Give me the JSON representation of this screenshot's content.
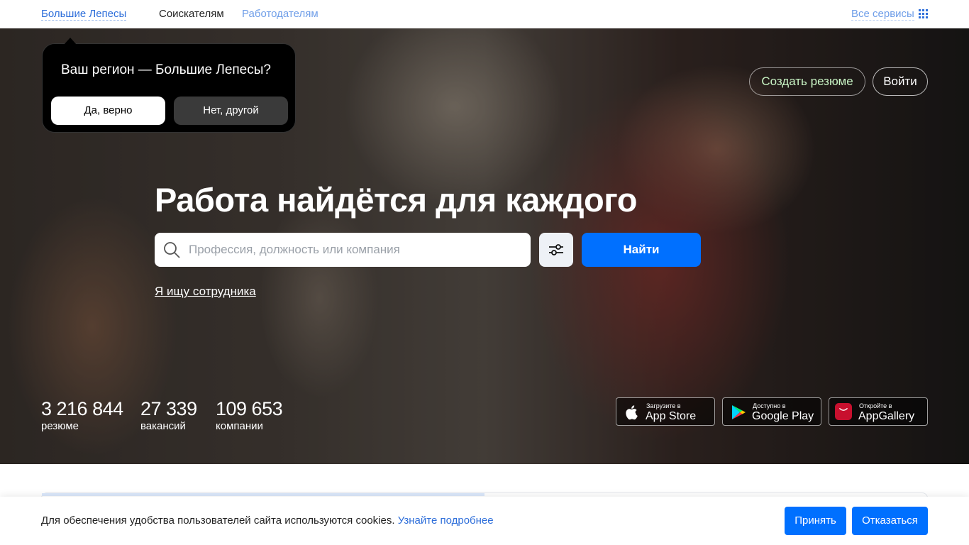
{
  "nav": {
    "region": "Большие Лепесы",
    "seekers": "Соискателям",
    "employers": "Работодателям",
    "all_services": "Все сервисы",
    "all_services_icon": "grid-icon"
  },
  "region_popup": {
    "title": "Ваш регион — Большие Лепесы?",
    "yes": "Да, верно",
    "no": "Нет, другой"
  },
  "header_actions": {
    "create_resume": "Создать резюме",
    "login": "Войти"
  },
  "hero": {
    "title": "Работа найдётся для каждого",
    "search_placeholder": "Профессия, должность или компания",
    "search_value": "",
    "search_icon": "search-icon",
    "filter_icon": "filters-icon",
    "find": "Найти",
    "employer_link": "Я ищу сотрудника"
  },
  "stats": [
    {
      "value": "3 216 844",
      "label": "резюме"
    },
    {
      "value": "27 339",
      "label": "вакансий"
    },
    {
      "value": "109 653",
      "label": "компании"
    }
  ],
  "stores": [
    {
      "small": "Загрузите в",
      "big": "App Store",
      "icon": "apple-icon"
    },
    {
      "small": "Доступно в",
      "big": "Google Play",
      "icon": "google-play-icon"
    },
    {
      "small": "Откройте в",
      "big": "AppGallery",
      "icon": "huawei-icon"
    }
  ],
  "cookie": {
    "text": "Для обеспечения удобства пользователей сайта используются cookies.",
    "link": "Узнайте подробнее",
    "accept": "Принять",
    "decline": "Отказаться"
  },
  "colors": {
    "accent": "#0070ff",
    "link": "#2f6fda",
    "create_resume_text": "#c9f5c5"
  }
}
